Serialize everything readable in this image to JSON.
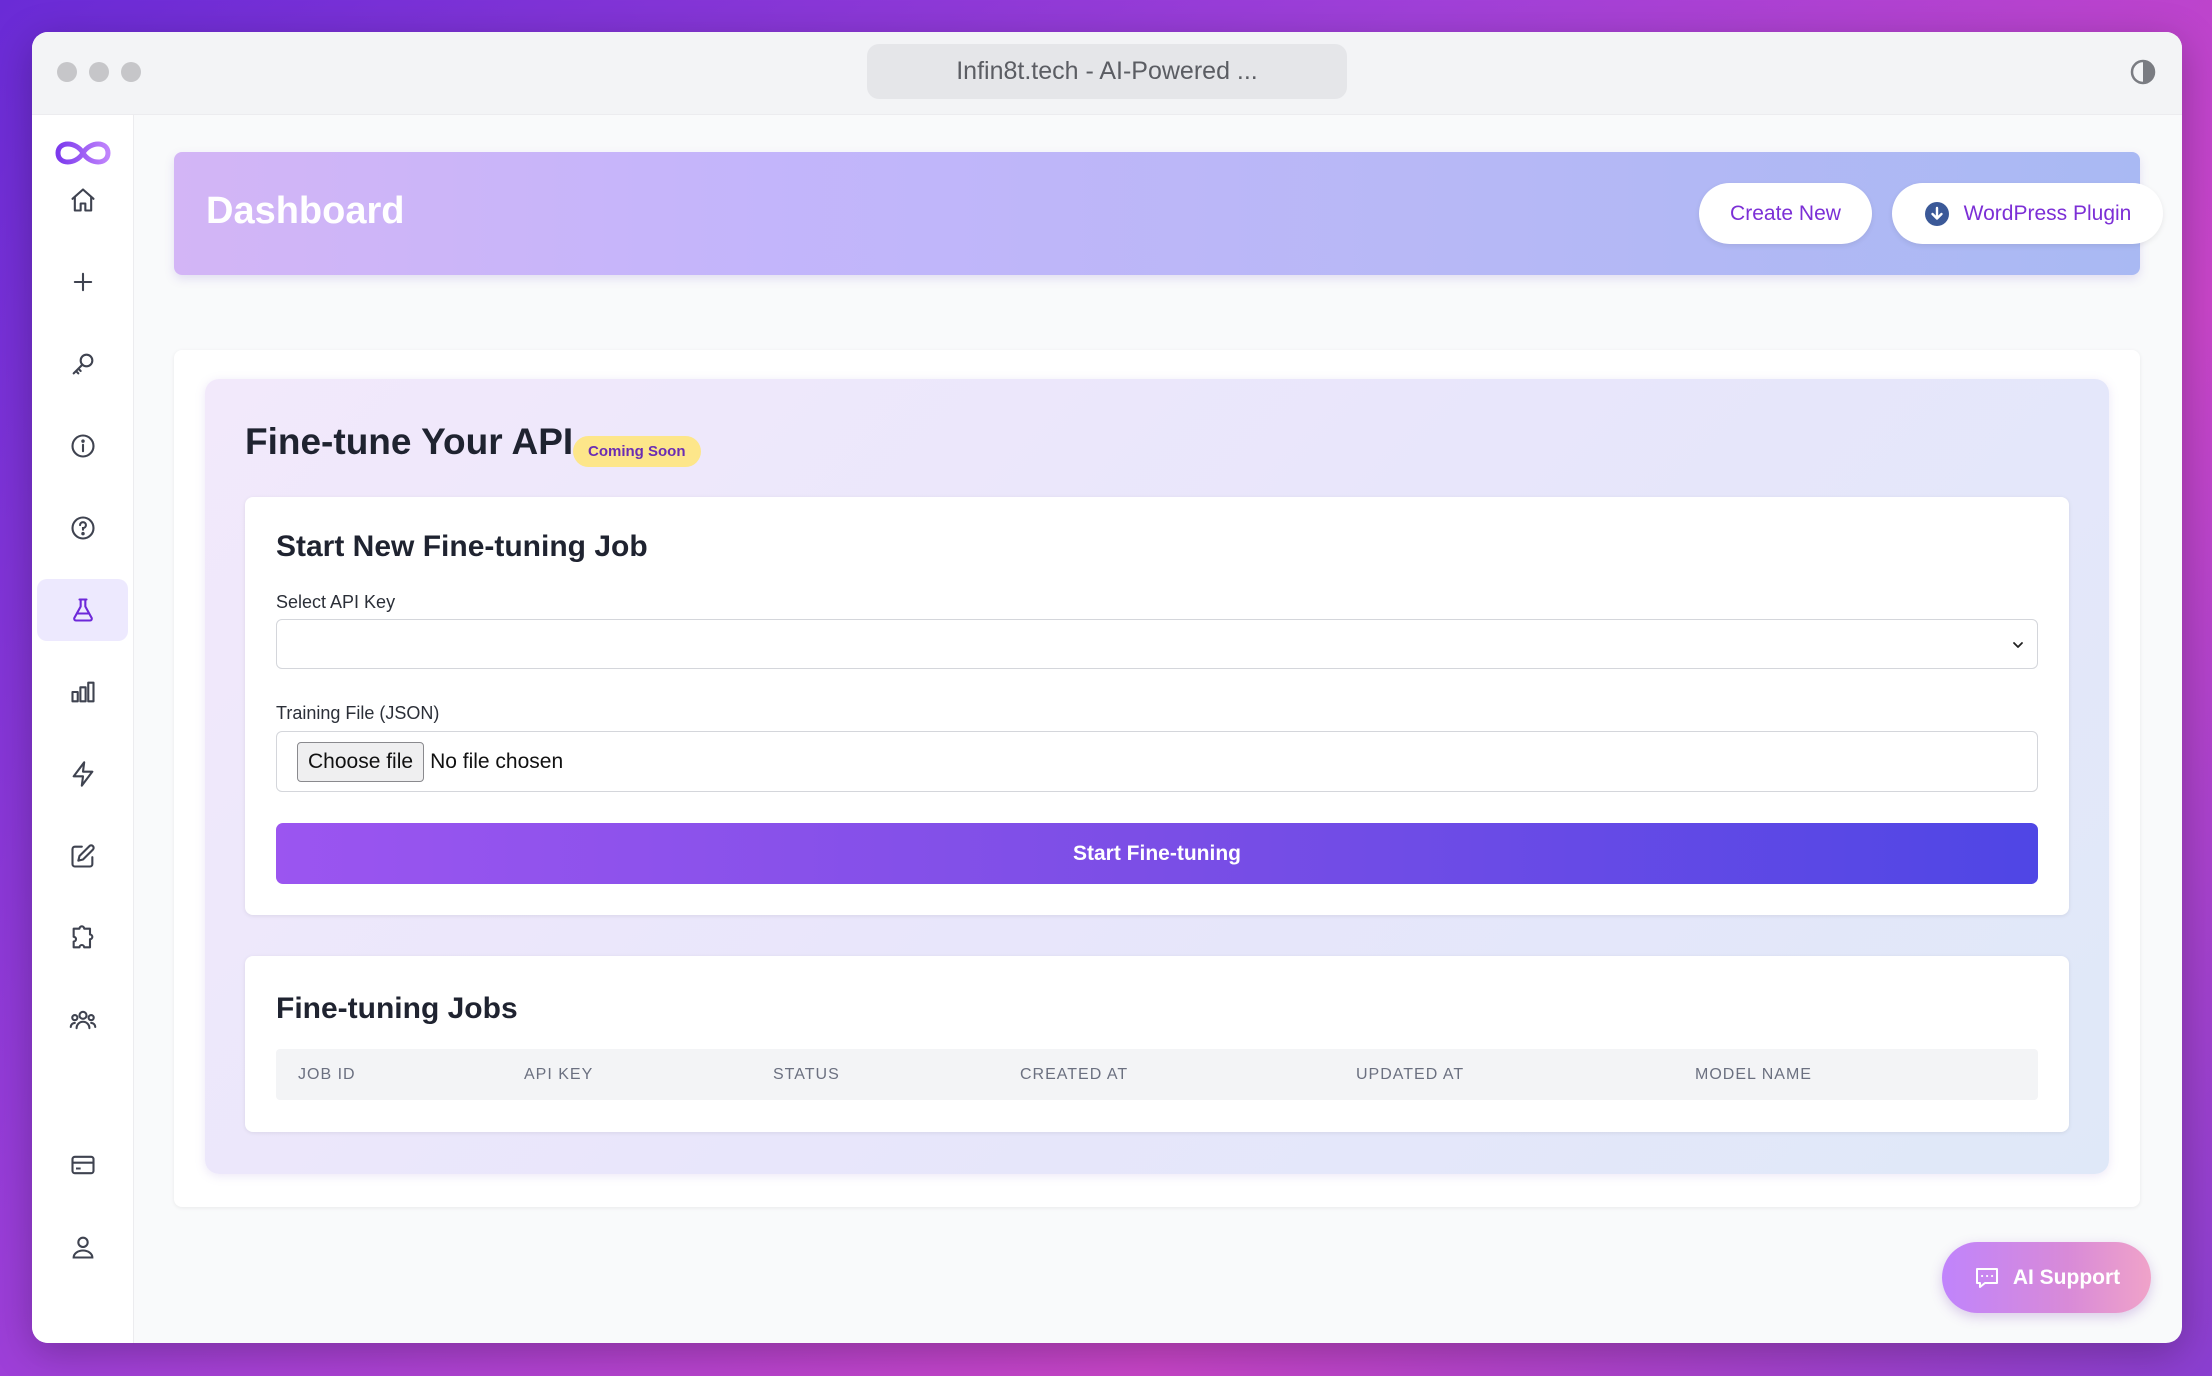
{
  "browser": {
    "tab_title": "Infin8t.tech - AI-Powered ..."
  },
  "sidebar": {
    "items": [
      {
        "icon": "home-icon",
        "active": false
      },
      {
        "icon": "plus-icon",
        "active": false
      },
      {
        "icon": "key-icon",
        "active": false
      },
      {
        "icon": "info-icon",
        "active": false
      },
      {
        "icon": "help-icon",
        "active": false
      },
      {
        "icon": "flask-icon",
        "active": true
      },
      {
        "icon": "bar-chart-icon",
        "active": false
      },
      {
        "icon": "lightning-icon",
        "active": false
      },
      {
        "icon": "edit-icon",
        "active": false
      },
      {
        "icon": "puzzle-icon",
        "active": false
      },
      {
        "icon": "users-icon",
        "active": false
      },
      {
        "icon": "credit-card-icon",
        "active": false
      },
      {
        "icon": "user-icon",
        "active": false
      }
    ]
  },
  "header": {
    "title": "Dashboard",
    "create_label": "Create New",
    "wordpress_label": "WordPress Plugin"
  },
  "finetune": {
    "title": "Fine-tune Your API",
    "badge": "Coming Soon",
    "form": {
      "heading": "Start New Fine-tuning Job",
      "api_key_label": "Select API Key",
      "api_key_value": "",
      "training_file_label": "Training File (JSON)",
      "file_button": "Choose file",
      "file_status": "No file chosen",
      "submit_label": "Start Fine-tuning"
    },
    "jobs": {
      "heading": "Fine-tuning Jobs",
      "columns": [
        "JOB ID",
        "API KEY",
        "STATUS",
        "CREATED AT",
        "UPDATED AT",
        "MODEL NAME"
      ],
      "rows": []
    }
  },
  "support": {
    "label": "AI Support"
  },
  "colors": {
    "accent": "#7c2fd6",
    "badge_bg": "#fde68a",
    "button_gradient_start": "#9b55f0",
    "button_gradient_end": "#4f46e5"
  }
}
